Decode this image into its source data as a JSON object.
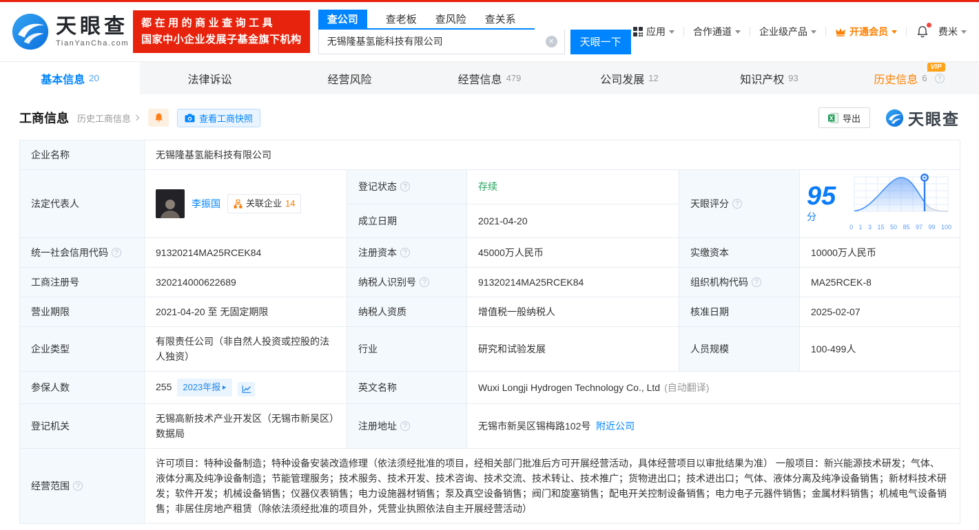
{
  "brand": {
    "name": "天眼查",
    "domain": "TianYanCha.com",
    "slogan_line1": "都在用的商业查询工具",
    "slogan_line2": "国家中小企业发展子基金旗下机构"
  },
  "colors": {
    "accent_blue": "#0084ff",
    "brand_red": "#e8230d",
    "vip_orange": "#ff8000",
    "status_green": "#21a35d"
  },
  "header": {
    "search_tabs": [
      "查公司",
      "查老板",
      "查风险",
      "查关系"
    ],
    "search_value": "无锡隆基氢能科技有限公司",
    "search_button": "天眼一下",
    "nav": [
      "应用",
      "合作通道",
      "企业级产品",
      "开通会员",
      "费米"
    ]
  },
  "vip_label": "VIP",
  "page_tabs": [
    {
      "label": "基本信息",
      "count": "20"
    },
    {
      "label": "法律诉讼",
      "count": ""
    },
    {
      "label": "经营风险",
      "count": ""
    },
    {
      "label": "经营信息",
      "count": "479"
    },
    {
      "label": "公司发展",
      "count": "12"
    },
    {
      "label": "知识产权",
      "count": "93"
    },
    {
      "label": "历史信息",
      "count": "6"
    }
  ],
  "section": {
    "title": "工商信息",
    "history_link": "历史工商信息",
    "snapshot_button": "查看工商快照",
    "export_button": "导出"
  },
  "score": {
    "label": "天眼评分",
    "value": "95",
    "unit": "分",
    "ticks": [
      "0",
      "1",
      "3",
      "15",
      "50",
      "85",
      "97",
      "99",
      "100"
    ],
    "marker_tick": "97",
    "chart_type": "area"
  },
  "biz": {
    "company_name_label": "企业名称",
    "company_name": "无锡隆基氢能科技有限公司",
    "legal_rep_label": "法定代表人",
    "person_name": "李振国",
    "related_label": "关联企业",
    "related_count": "14",
    "reg_status_label": "登记状态",
    "reg_status": "存续",
    "est_date_label": "成立日期",
    "est_date": "2021-04-20",
    "credit_code_label": "统一社会信用代码",
    "credit_code": "91320214MA25RCEK84",
    "reg_capital_label": "注册资本",
    "reg_capital": "45000万人民币",
    "paid_capital_label": "实缴资本",
    "paid_capital": "10000万人民币",
    "reg_number_label": "工商注册号",
    "reg_number": "320214000622689",
    "taxpayer_id_label": "纳税人识别号",
    "taxpayer_id": "91320214MA25RCEK84",
    "org_code_label": "组织机构代码",
    "org_code": "MA25RCEK-8",
    "business_term_label": "营业期限",
    "business_term": "2021-04-20 至 无固定期限",
    "taxpayer_quality_label": "纳税人资质",
    "taxpayer_quality": "增值税一般纳税人",
    "approval_date_label": "核准日期",
    "approval_date": "2025-02-07",
    "company_type_label": "企业类型",
    "company_type": "有限责任公司（非自然人投资或控股的法人独资）",
    "industry_label": "行业",
    "industry": "研究和试验发展",
    "staff_size_label": "人员规模",
    "staff_size": "100-499人",
    "insured_label": "参保人数",
    "insured_count": "255",
    "annual_report_badge": "2023年报",
    "english_name_label": "英文名称",
    "english_name": "Wuxi Longji Hydrogen Technology Co., Ltd",
    "english_name_note": "(自动翻译)",
    "reg_authority_label": "登记机关",
    "reg_authority": "无锡高新技术产业开发区（无锡市新吴区）数据局",
    "address_label": "注册地址",
    "address": "无锡市新吴区锡梅路102号",
    "nearby_link": "附近公司",
    "business_scope_label": "经营范围",
    "business_scope": "许可项目：特种设备制造；特种设备安装改造修理（依法须经批准的项目，经相关部门批准后方可开展经营活动，具体经营项目以审批结果为准）  一般项目：新兴能源技术研发；气体、液体分离及纯净设备制造；节能管理服务；技术服务、技术开发、技术咨询、技术交流、技术转让、技术推广；货物进出口；技术进出口；气体、液体分离及纯净设备销售；新材料技术研发；软件开发；机械设备销售；仪器仪表销售；电力设施器材销售；泵及真空设备销售；阀门和旋塞销售；配电开关控制设备销售；电力电子元器件销售；金属材料销售；机械电气设备销售；非居住房地产租赁（除依法须经批准的项目外，凭营业执照依法自主开展经营活动）"
  }
}
